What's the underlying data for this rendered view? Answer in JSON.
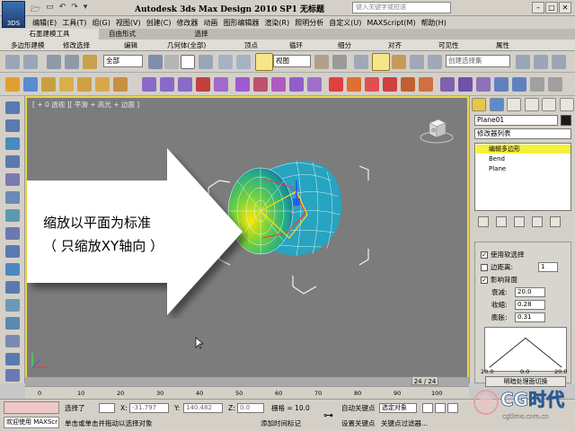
{
  "window": {
    "title": "Autodesk 3ds Max Design 2010 SP1     无标题",
    "search_placeholder": "键入关键字或短语",
    "logo_text": "3DS"
  },
  "quick_access": [
    "🗁",
    "▭",
    "↶",
    "↷",
    "▾"
  ],
  "menu": [
    "编辑(E)",
    "工具(T)",
    "组(G)",
    "视图(V)",
    "创建(C)",
    "修改器",
    "动画",
    "图形编辑器",
    "渲染(R)",
    "照明分析",
    "自定义(U)",
    "MAXScript(M)",
    "帮助(H)"
  ],
  "ribbon": {
    "tabs": [
      "石墨建模工具",
      "自由形式",
      "选择"
    ],
    "sub": [
      "多边形建模",
      "修改选择",
      "编辑",
      "几何体(全部)",
      "顶点",
      "循环",
      "细分",
      "对齐",
      "可见性",
      "属性"
    ]
  },
  "toolbar": {
    "filter": "全部",
    "ref_coord": "视图",
    "sel_set": "创建选择集"
  },
  "viewport": {
    "label": "[ + 0 透视 ][ 平滑 + 高光 + 边面 ]",
    "caption_line1": "缩放以平面为标准",
    "caption_line2": "（ 只缩放XY轴向 ）",
    "viewcube_label": "前"
  },
  "command_panel": {
    "object_name": "Plane01",
    "modifier_list": "修改器列表",
    "stack": [
      "编辑多边形",
      "Bend",
      "Plane"
    ],
    "soft_selection": {
      "use_soft": "使用软选择",
      "edge_distance": "边距离:",
      "edge_distance_value": "1",
      "affect_backfacing": "影响背面",
      "falloff_label": "衰减:",
      "falloff": "20.0",
      "pinch_label": "收缩:",
      "pinch": "0.28",
      "bubble_label": "膨胀:",
      "bubble": "0.31",
      "graph_left": "20.0",
      "graph_center": "0.0",
      "graph_right": "20.0",
      "shade_button": "明暗处理面切换"
    }
  },
  "timeline": {
    "frame": "24 / 24",
    "ticks": [
      "0",
      "10",
      "20",
      "30",
      "40",
      "50",
      "60",
      "70",
      "80",
      "90",
      "100"
    ]
  },
  "status": {
    "welcome": "欢迎使用 MAXScr",
    "selected": "选择了",
    "hint": "单击或单击并拖动以选择对象",
    "x_label": "X:",
    "x_value": "-31.797",
    "y_label": "Y:",
    "y_value": "140.482",
    "z_label": "Z:",
    "z_value": "0.0",
    "grid": "栅格 = 10.0",
    "add_time_tag": "添加时间标记",
    "auto_key": "自动关键点",
    "selected_object": "选定对象",
    "set_key": "设置关键点",
    "key_filters": "关键点过滤器..."
  },
  "watermark": {
    "brand": "CG时代",
    "url": "cgtime.com.cn"
  },
  "colors": {
    "viewport_bg": "#7c7c7c",
    "active_border": "#e8d648",
    "arrow_fill": "#ffffff",
    "stack_highlight": "#f5f03a",
    "mesh_green": "#2fd07a"
  }
}
